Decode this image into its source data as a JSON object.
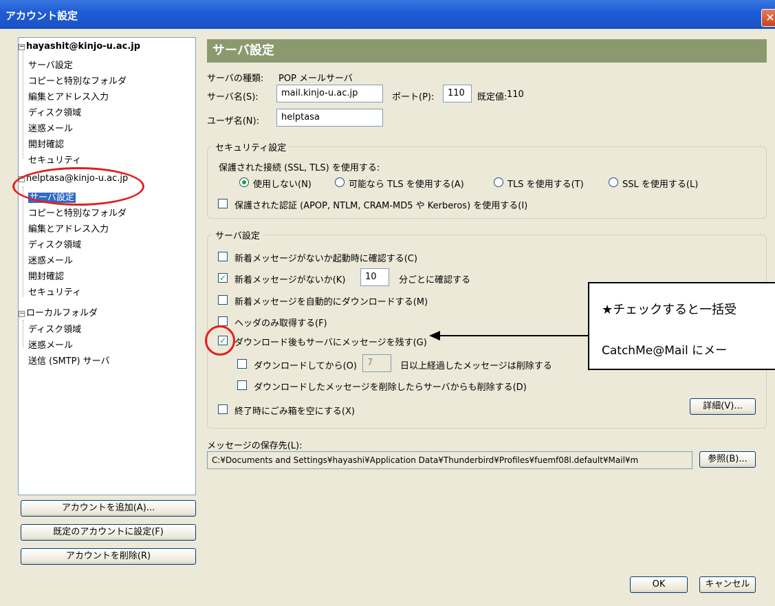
{
  "window": {
    "title": "アカウント設定",
    "close_glyph": "✕"
  },
  "tree": {
    "accounts": [
      {
        "name": "hayashit@kinjo-u.ac.jp",
        "children": [
          "サーバ設定",
          "コピーと特別なフォルダ",
          "編集とアドレス入力",
          "ディスク領域",
          "迷惑メール",
          "開封確認",
          "セキュリティ"
        ]
      },
      {
        "name": "helptasa@kinjo-u.ac.jp",
        "children": [
          "サーバ設定",
          "コピーと特別なフォルダ",
          "編集とアドレス入力",
          "ディスク領域",
          "迷惑メール",
          "開封確認",
          "セキュリティ"
        ],
        "selected_child": 0
      },
      {
        "name": "ローカルフォルダ",
        "children": [
          "ディスク領域",
          "迷惑メール"
        ]
      }
    ],
    "smtp": "送信 (SMTP) サーバ",
    "toggle_glyph": "−"
  },
  "left_buttons": {
    "add": "アカウントを追加(A)...",
    "set_default": "既定のアカウントに設定(F)",
    "delete": "アカウントを削除(R)"
  },
  "panel": {
    "title": "サーバ設定",
    "server_type_label": "サーバの種類:",
    "server_type_value": "POP メールサーバ",
    "server_name_label": "サーバ名(S):",
    "server_name_value": "mail.kinjo-u.ac.jp",
    "port_label": "ポート(P):",
    "port_value": "110",
    "default_label": "既定値:",
    "default_value": "110",
    "user_label": "ユーザ名(N):",
    "user_value": "helptasa"
  },
  "security": {
    "group_title": "セキュリティ設定",
    "ssl_label": "保護された接続 (SSL, TLS) を使用する:",
    "options": [
      "使用しない(N)",
      "可能なら TLS を使用する(A)",
      "TLS を使用する(T)",
      "SSL を使用する(L)"
    ],
    "selected_option": 0,
    "secure_auth": "保護された認証 (APOP, NTLM, CRAM-MD5 や Kerberos) を使用する(I)",
    "secure_auth_checked": false
  },
  "server_settings": {
    "group_title": "サーバ設定",
    "check_on_startup": "新着メッセージがないか起動時に確認する(C)",
    "check_on_startup_checked": false,
    "check_every": "新着メッセージがないか(K)",
    "check_every_checked": true,
    "check_every_minutes": "10",
    "check_every_suffix": "分ごとに確認する",
    "auto_download": "新着メッセージを自動的にダウンロードする(M)",
    "auto_download_checked": false,
    "headers_only": "ヘッダのみ取得する(F)",
    "headers_only_checked": false,
    "leave_on_server": "ダウンロード後もサーバにメッセージを残す(G)",
    "leave_on_server_checked": true,
    "delete_after": "ダウンロードしてから(O)",
    "delete_after_days": "7",
    "delete_after_suffix": "日以上経過したメッセージは削除する",
    "delete_after_checked": false,
    "delete_when_deleted": "ダウンロードしたメッセージを削除したらサーバからも削除する(D)",
    "delete_when_deleted_checked": false,
    "empty_trash": "終了時にごみ箱を空にする(X)",
    "empty_trash_checked": false,
    "advanced_button": "詳細(V)...",
    "check_glyph": "✓"
  },
  "storage": {
    "label": "メッセージの保存先(L):",
    "path": "C:¥Documents and Settings¥hayashi¥Application Data¥Thunderbird¥Profiles¥fuemf08l.default¥Mail¥m",
    "browse_button": "参照(B)..."
  },
  "footer": {
    "ok": "OK",
    "cancel": "キャンセル"
  },
  "callout": {
    "line1": "★チェックすると一括受",
    "line2": "CatchMe@Mail にメー"
  },
  "colors": {
    "accent_header": "#8a9a6e",
    "annotation": "#e41e1e",
    "selection": "#316ac5"
  }
}
